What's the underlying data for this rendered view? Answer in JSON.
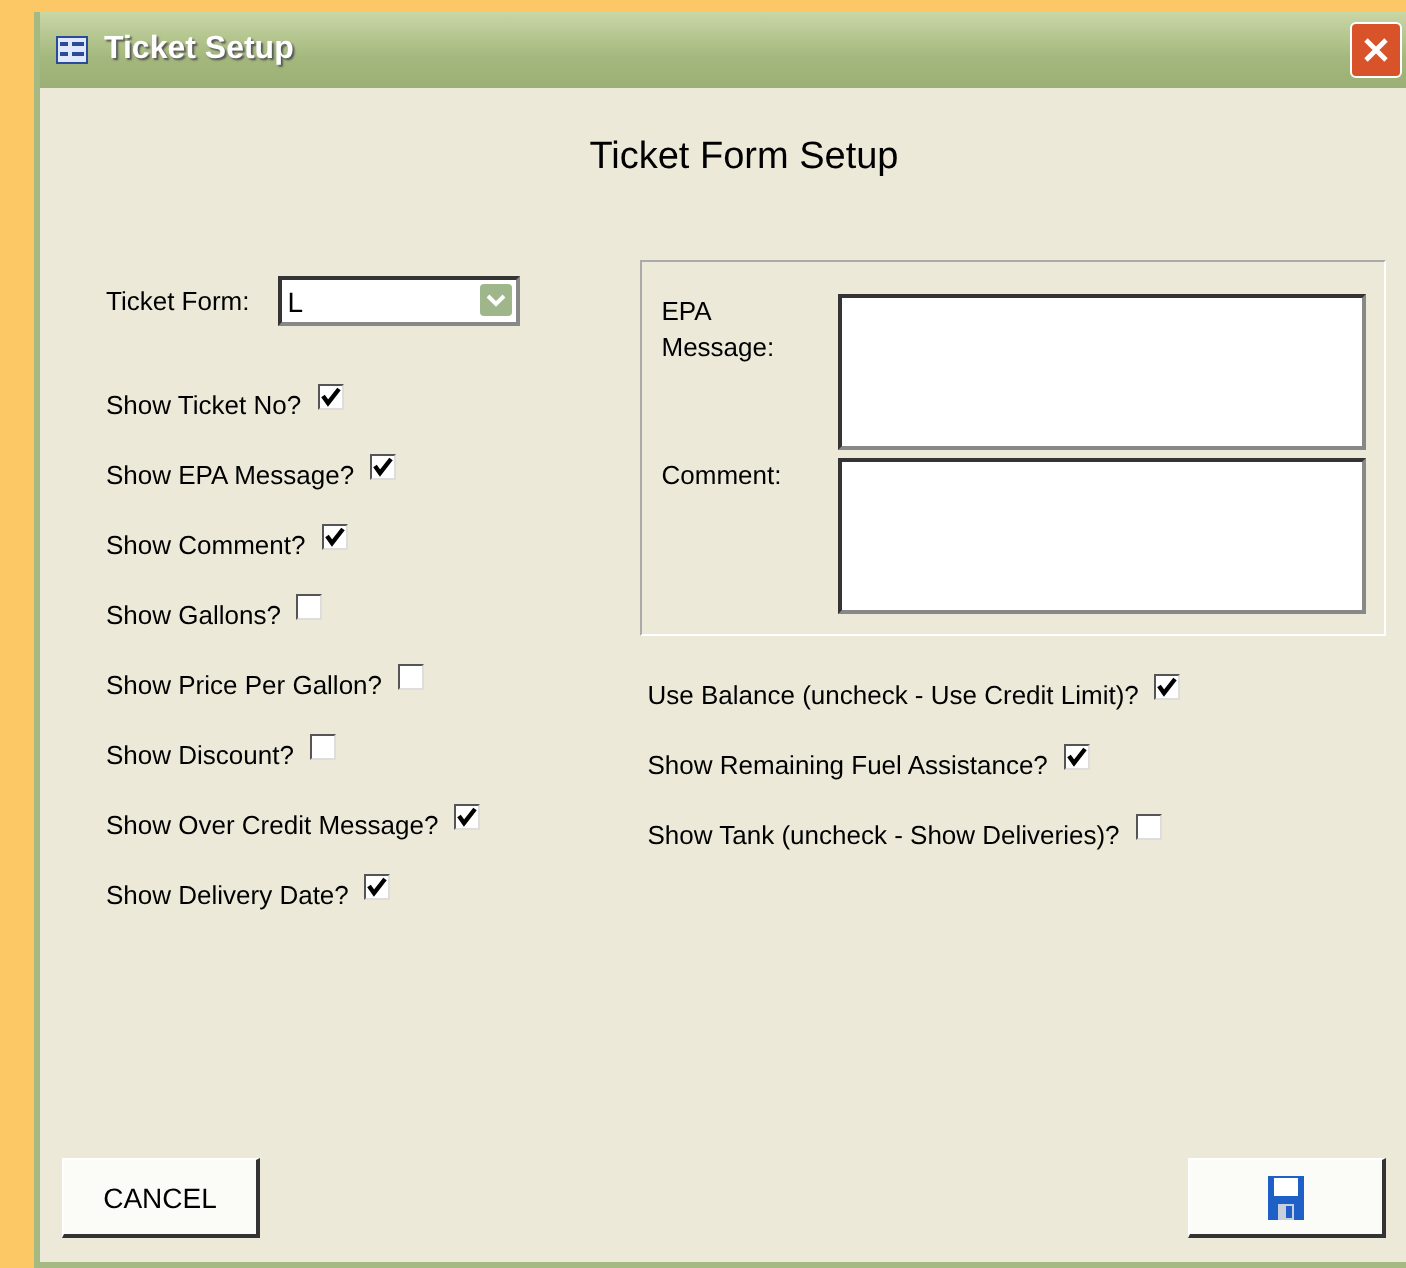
{
  "window": {
    "title": "Ticket Setup"
  },
  "heading": "Ticket Form Setup",
  "ticket_form": {
    "label": "Ticket Form:",
    "value": "L"
  },
  "left_options": [
    {
      "label": "Show Ticket No?",
      "checked": true
    },
    {
      "label": "Show EPA Message?",
      "checked": true
    },
    {
      "label": "Show Comment?",
      "checked": true
    },
    {
      "label": "Show Gallons?",
      "checked": false
    },
    {
      "label": "Show Price Per Gallon?",
      "checked": false
    },
    {
      "label": "Show Discount?",
      "checked": false
    },
    {
      "label": "Show Over Credit Message?",
      "checked": true
    },
    {
      "label": "Show Delivery Date?",
      "checked": true
    }
  ],
  "text_fields": [
    {
      "label": "EPA Message:"
    },
    {
      "label": "Comment:"
    }
  ],
  "right_options": [
    {
      "label": "Use Balance (uncheck - Use Credit Limit)?",
      "checked": true
    },
    {
      "label": "Show Remaining Fuel Assistance?",
      "checked": true
    },
    {
      "label": "Show Tank (uncheck - Show Deliveries)?",
      "checked": false
    }
  ],
  "buttons": {
    "cancel": "CANCEL"
  }
}
